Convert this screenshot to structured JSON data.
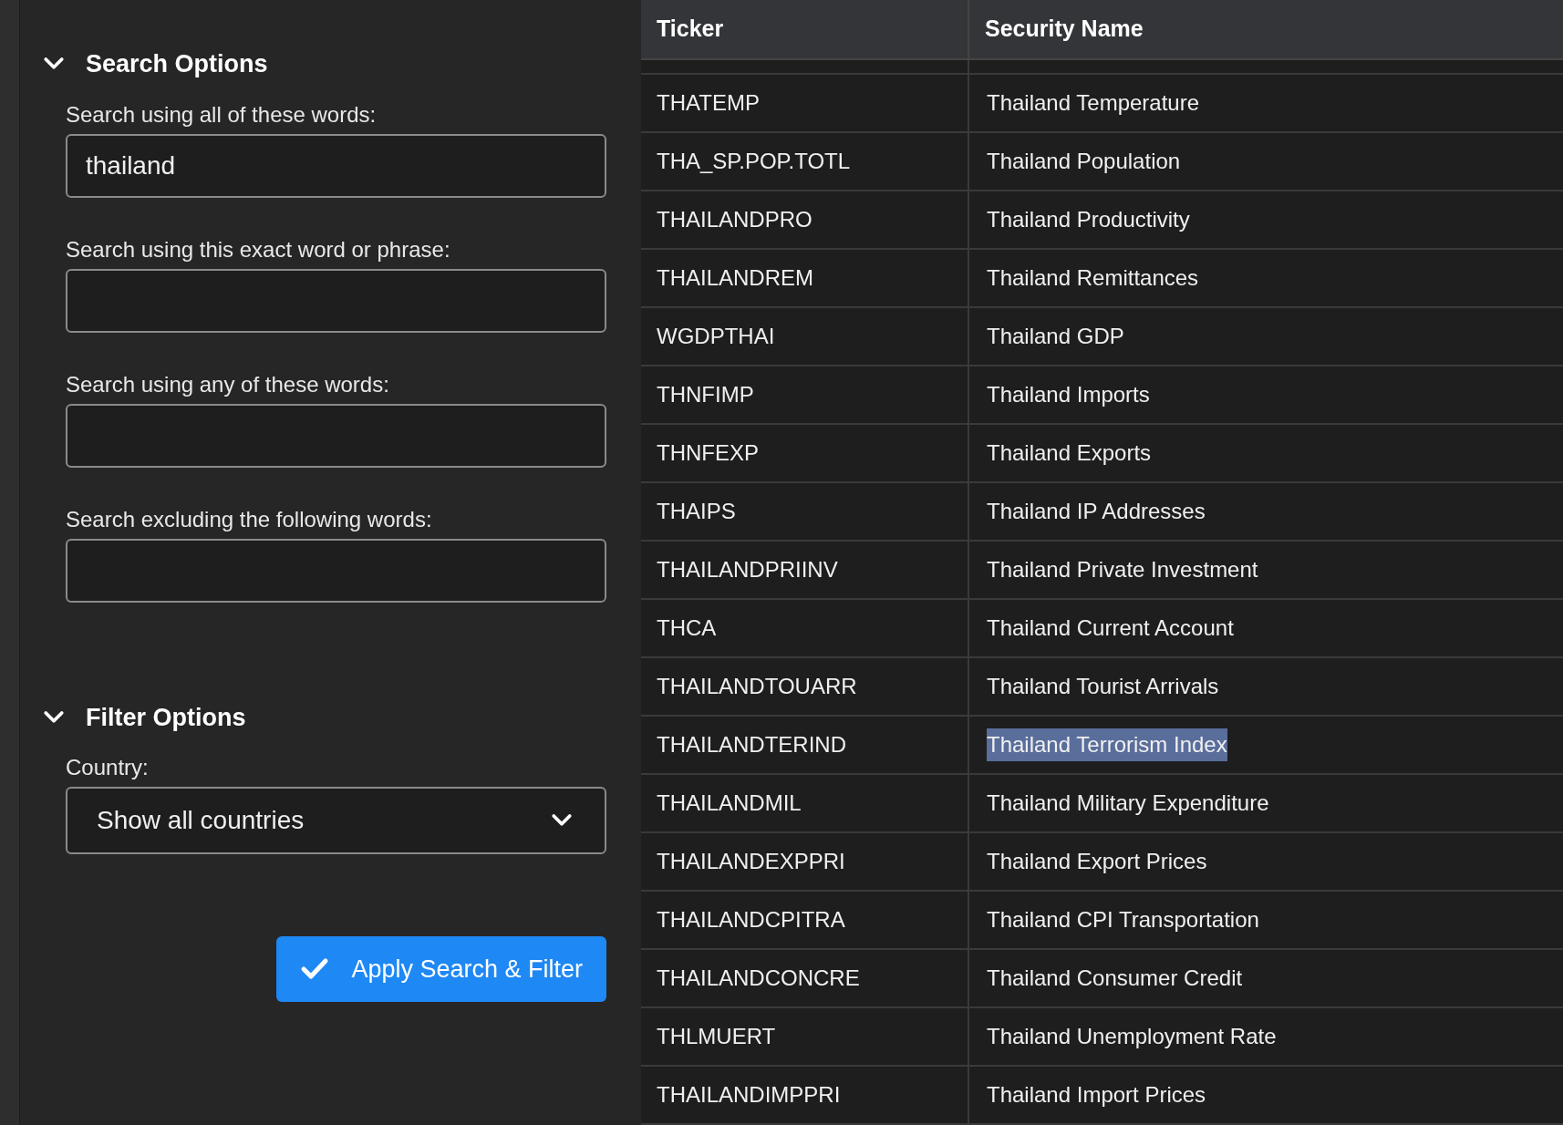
{
  "sidebar": {
    "sections": [
      {
        "title": "Search Options",
        "expanded": true,
        "fields": [
          {
            "kind": "text",
            "label": "Search using all of these words:",
            "value": "thailand"
          },
          {
            "kind": "text",
            "label": "Search using this exact word or phrase:"
          },
          {
            "kind": "text",
            "label": "Search using any of these words:"
          },
          {
            "kind": "text",
            "label": "Search excluding the following words:"
          }
        ]
      },
      {
        "title": "Filter Options",
        "expanded": true,
        "fields": [
          {
            "kind": "select",
            "label": "Country:",
            "value": "Show all countries"
          }
        ]
      }
    ],
    "apply_button": "Apply Search & Filter"
  },
  "table": {
    "columns": [
      "Ticker",
      "Security Name"
    ],
    "rows": [
      {
        "ticker": "THATEMP",
        "name": "Thailand Temperature",
        "text_selected": false
      },
      {
        "ticker": "THA_SP.POP.TOTL",
        "name": "Thailand Population",
        "text_selected": false
      },
      {
        "ticker": "THAILANDPRO",
        "name": "Thailand Productivity",
        "text_selected": false
      },
      {
        "ticker": "THAILANDREM",
        "name": "Thailand Remittances",
        "text_selected": false
      },
      {
        "ticker": "WGDPTHAI",
        "name": "Thailand GDP",
        "text_selected": false
      },
      {
        "ticker": "THNFIMP",
        "name": "Thailand Imports",
        "text_selected": false
      },
      {
        "ticker": "THNFEXP",
        "name": "Thailand Exports",
        "text_selected": false
      },
      {
        "ticker": "THAIPS",
        "name": "Thailand IP Addresses",
        "text_selected": false
      },
      {
        "ticker": "THAILANDPRIINV",
        "name": "Thailand Private Investment",
        "text_selected": false
      },
      {
        "ticker": "THCA",
        "name": "Thailand Current Account",
        "text_selected": false
      },
      {
        "ticker": "THAILANDTOUARR",
        "name": "Thailand Tourist Arrivals",
        "text_selected": false
      },
      {
        "ticker": "THAILANDTERIND",
        "name": "Thailand Terrorism Index",
        "text_selected": true
      },
      {
        "ticker": "THAILANDMIL",
        "name": "Thailand Military Expenditure",
        "text_selected": false
      },
      {
        "ticker": "THAILANDEXPPRI",
        "name": "Thailand Export Prices",
        "text_selected": false
      },
      {
        "ticker": "THAILANDCPITRA",
        "name": "Thailand CPI Transportation",
        "text_selected": false
      },
      {
        "ticker": "THAILANDCONCRE",
        "name": "Thailand Consumer Credit",
        "text_selected": false
      },
      {
        "ticker": "THLMUERT",
        "name": "Thailand Unemployment Rate",
        "text_selected": false
      },
      {
        "ticker": "THAILANDIMPPRI",
        "name": "Thailand Import Prices",
        "text_selected": false
      }
    ]
  }
}
